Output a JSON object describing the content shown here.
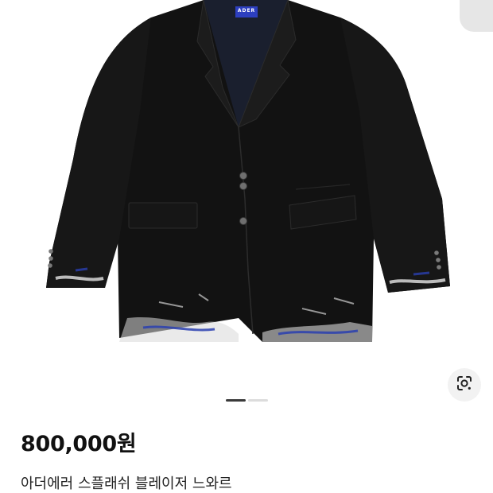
{
  "product": {
    "brand_tag": "ADER",
    "price": "800,000원",
    "title": "아더에러 스플래쉬 블레이저 느와르"
  },
  "gallery": {
    "page_count": 2,
    "active_page": 1
  },
  "icons": {
    "lens_button": "google-lens-icon"
  },
  "colors": {
    "jacket": "#121212",
    "paint_blue": "#2a3fb0",
    "brand_tag": "#2d3fbf",
    "pager_active": "#3a3a3a",
    "pager_inactive": "#dcdcdc"
  }
}
